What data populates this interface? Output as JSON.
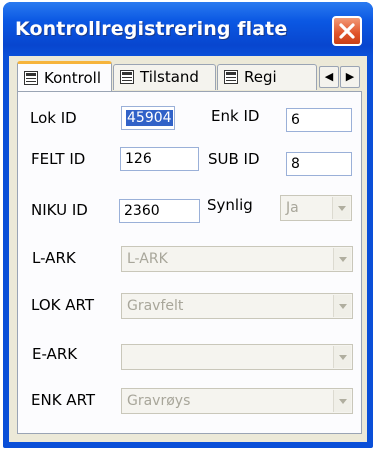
{
  "window": {
    "title": "Kontrollregistrering flate"
  },
  "tabs": [
    {
      "label": "Kontroll",
      "active": true
    },
    {
      "label": "Tilstand",
      "active": false
    },
    {
      "label": "Regi",
      "active": false
    }
  ],
  "tab_scroll": {
    "left": "◀",
    "right": "▶"
  },
  "form": {
    "lok_id": {
      "label": "Lok ID",
      "value": "45904"
    },
    "enk_id": {
      "label": "Enk ID",
      "value": "6"
    },
    "felt_id": {
      "label": "FELT ID",
      "value": "126"
    },
    "sub_id": {
      "label": "SUB ID",
      "value": "8"
    },
    "niku_id": {
      "label": "NIKU ID",
      "value": "2360"
    },
    "synlig": {
      "label": "Synlig",
      "value": "Ja"
    },
    "l_ark": {
      "label": "L-ARK",
      "value": "L-ARK"
    },
    "lok_art": {
      "label": "LOK ART",
      "value": "Gravfelt"
    },
    "e_ark": {
      "label": "E-ARK",
      "value": ""
    },
    "enk_art": {
      "label": "ENK ART",
      "value": "Gravrøys"
    }
  },
  "colors": {
    "titlebar": "#0a4fd8",
    "close_button": "#e0532a",
    "active_tab_accent": "#f6b43c",
    "selection": "#3162c8"
  },
  "icons": [
    "close-icon",
    "tab-form-icon",
    "scroll-left-icon",
    "scroll-right-icon",
    "dropdown-arrow-icon"
  ]
}
